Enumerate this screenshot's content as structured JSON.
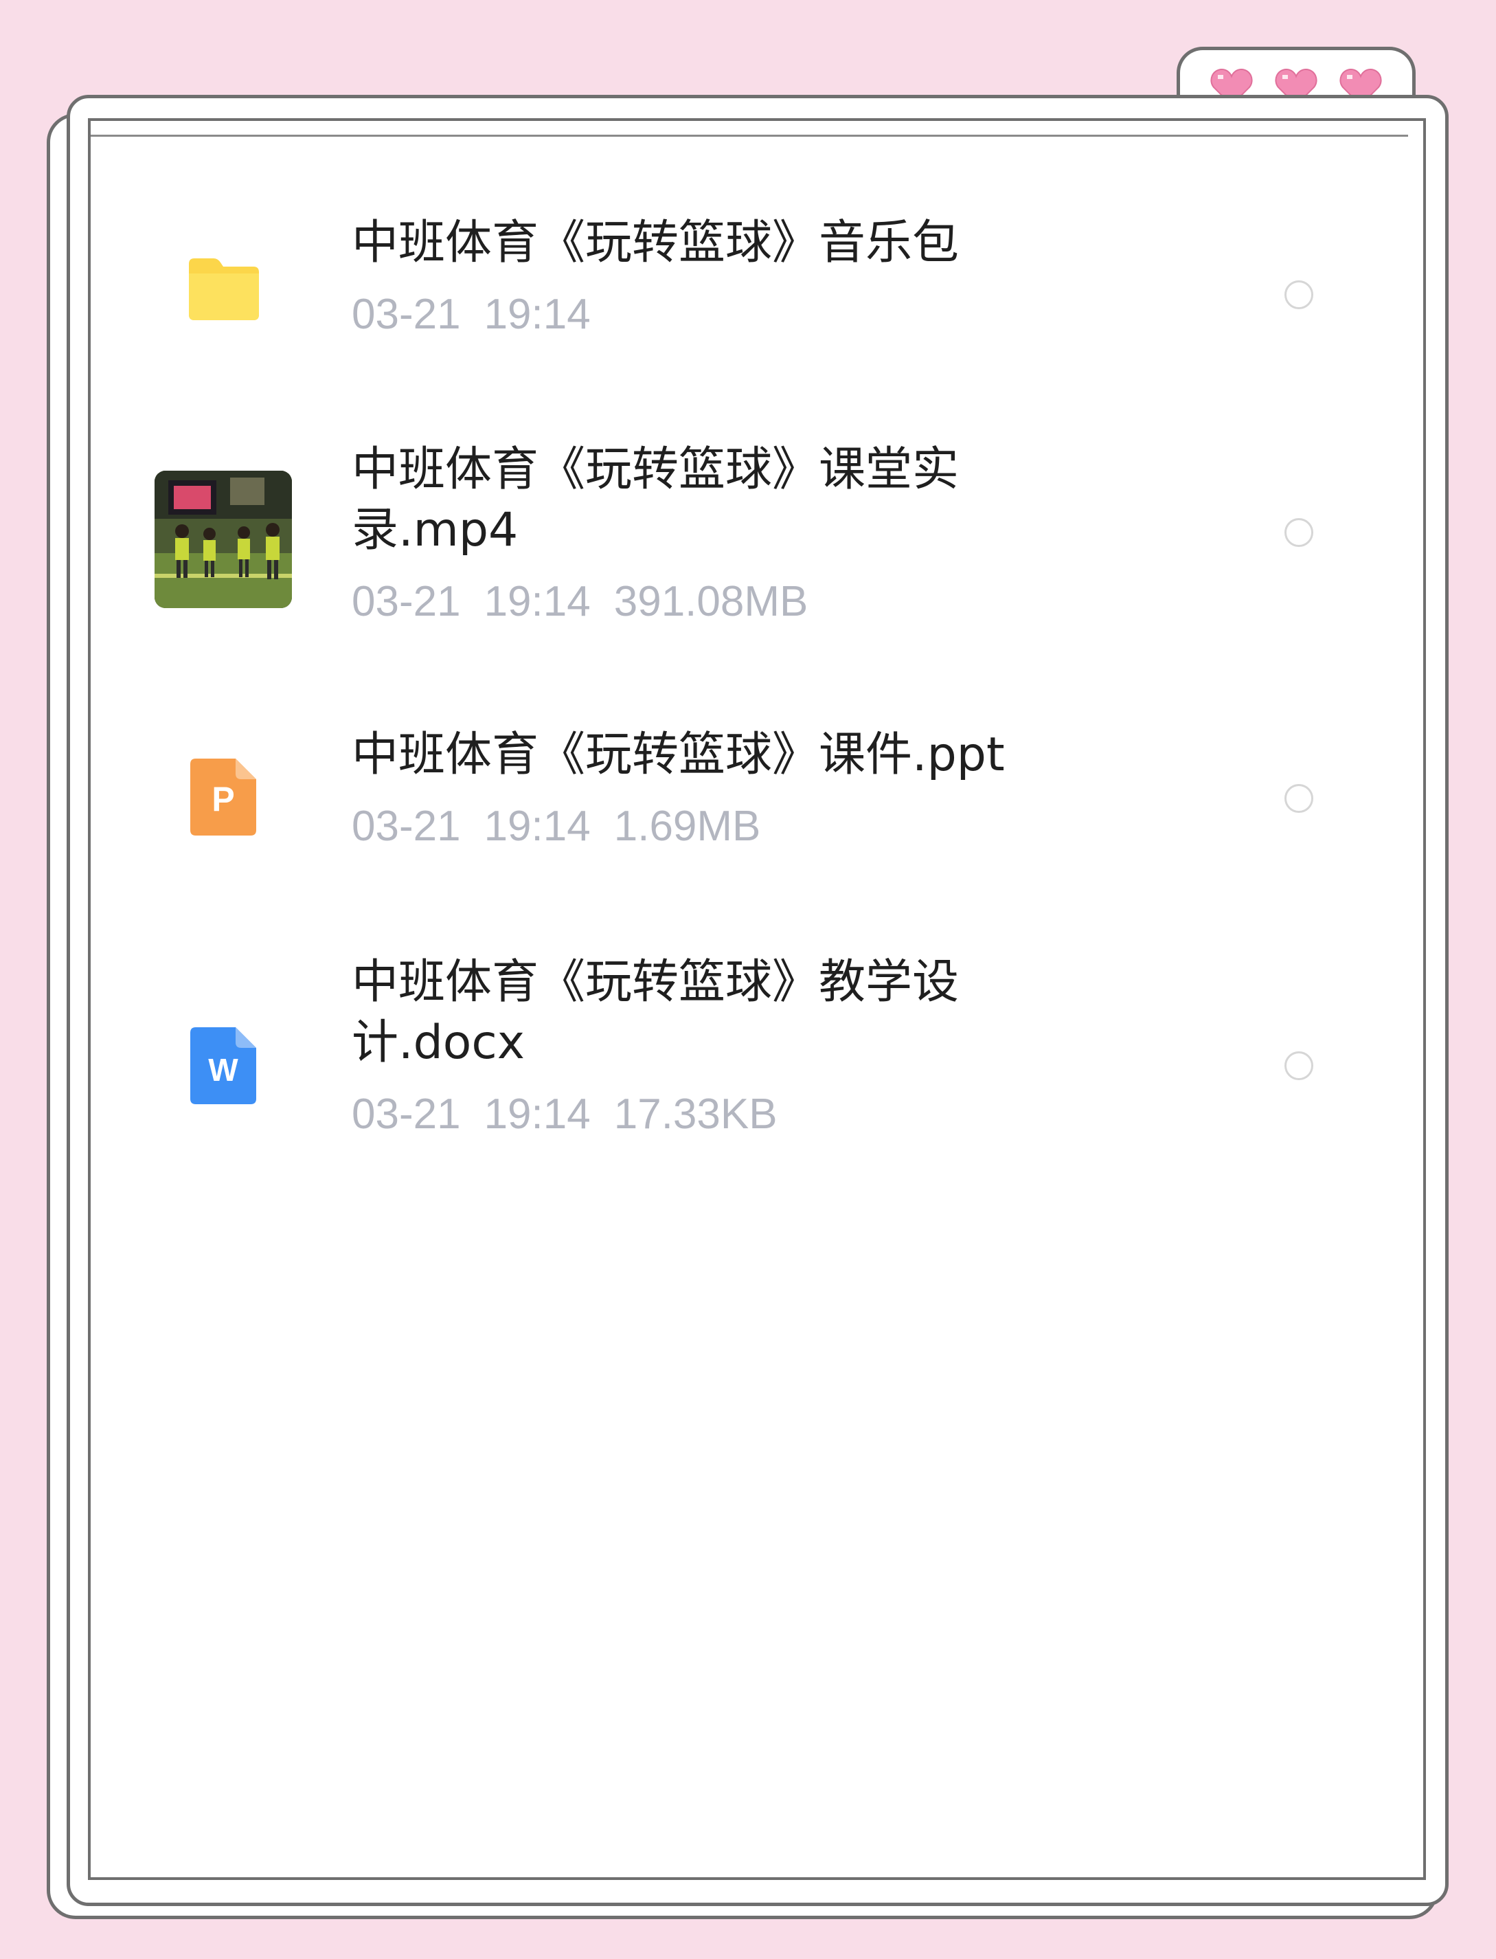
{
  "files": [
    {
      "name": "中班体育《玩转篮球》音乐包",
      "date": "03-21",
      "time": "19:14",
      "size": "",
      "icon": "folder-icon",
      "icon_color": "#fcd64a"
    },
    {
      "name": "中班体育《玩转篮球》课堂实\n录.mp4",
      "date": "03-21",
      "time": "19:14",
      "size": "391.08MB",
      "icon": "video-thumbnail"
    },
    {
      "name": "中班体育《玩转篮球》课件.ppt",
      "date": "03-21",
      "time": "19:14",
      "size": "1.69MB",
      "icon": "ppt-icon",
      "icon_color": "#f79d4a",
      "icon_letter": "P"
    },
    {
      "name": "中班体育《玩转篮球》教学设\n计.docx",
      "date": "03-21",
      "time": "19:14",
      "size": "17.33KB",
      "icon": "word-icon",
      "icon_color": "#3d8ff5",
      "icon_letter": "W"
    }
  ],
  "colors": {
    "background": "#f9dde8",
    "heart": "#f28cb4",
    "meta_text": "#b3b6c0"
  }
}
